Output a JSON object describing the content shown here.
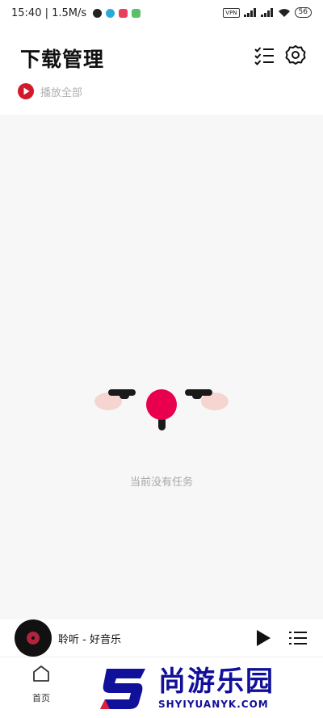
{
  "status_bar": {
    "time_speed": "15:40 | 1.5M/s",
    "vpn_label": "VPN",
    "battery": "56"
  },
  "header": {
    "title": "下载管理"
  },
  "actions": {
    "play_all_label": "播放全部"
  },
  "empty_state": {
    "message": "当前没有任务"
  },
  "mini_player": {
    "song_title": "聆听 - 好音乐"
  },
  "bottom_nav": {
    "home_label": "首页"
  },
  "watermark": {
    "brand": "尚游乐园",
    "domain": "SHYIYUANYK.COM"
  },
  "colors": {
    "accent": "#e8004e",
    "play_all_red": "#d21a2a",
    "watermark_blue": "#11109a"
  }
}
